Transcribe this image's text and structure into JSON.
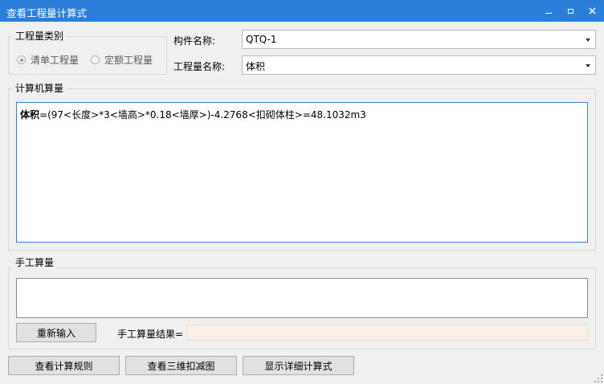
{
  "window": {
    "title": "查看工程量计算式"
  },
  "quantity_type": {
    "group_title": "工程量类别",
    "options": [
      {
        "label": "清单工程量",
        "checked": true
      },
      {
        "label": "定额工程量",
        "checked": false
      }
    ]
  },
  "component": {
    "label": "构件名称:",
    "value": "QTQ-1"
  },
  "quantity_name": {
    "label": "工程量名称:",
    "value": "体积"
  },
  "computer_calc": {
    "group_title": "计算机算量",
    "formula_name": "体积",
    "formula_expr": "=(97<长度>*3<墙高>*0.18<墙厚>)-4.2768<扣砌体柱>=48.1032m3"
  },
  "manual_calc": {
    "group_title": "手工算量",
    "input_value": "",
    "reenter_label": "重新输入",
    "result_label": "手工算量结果=",
    "result_value": ""
  },
  "footer": {
    "view_rules_label": "查看计算规则",
    "view_3d_label": "查看三维扣减图",
    "show_detail_label": "显示详细计算式"
  },
  "colors": {
    "titlebar": "#2b7fd8",
    "calc_border": "#3d7fd0",
    "result_field_bg": "#faf0e6"
  }
}
